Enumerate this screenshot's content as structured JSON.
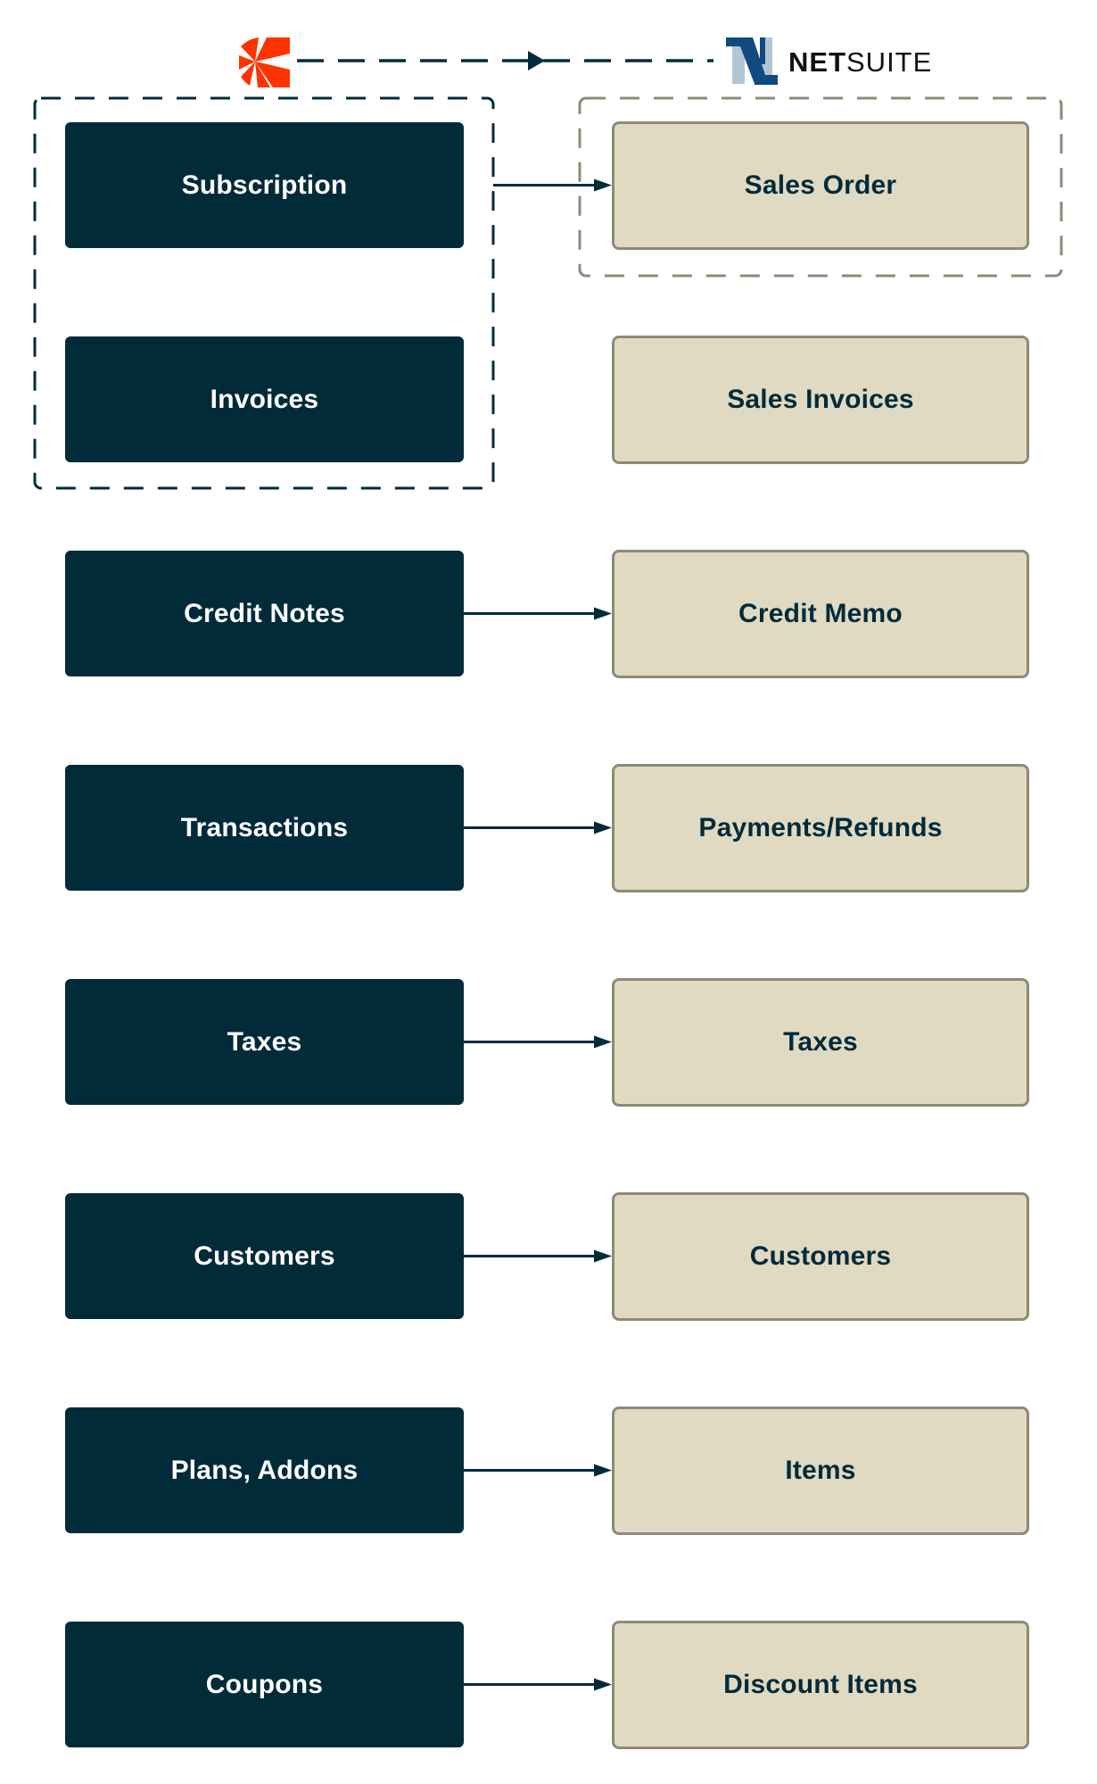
{
  "header": {
    "source_logo": "chargebee-logo",
    "target_logo": "netsuite-logo",
    "target_brand_bold": "NET",
    "target_brand_regular": "SUITE",
    "flow_direction_icon": "arrow-right-icon"
  },
  "colors": {
    "source_box": "#022b3a",
    "target_box": "#e0dac2",
    "target_border": "#8f8a77",
    "connector": "#022b3a",
    "chargebee_orange": "#ff3300",
    "netsuite_dark_blue": "#0f4a80",
    "netsuite_light_blue": "#b4c6d3"
  },
  "groups": {
    "source_group": [
      "Subscription",
      "Invoices"
    ],
    "target_group": [
      "Sales Order"
    ]
  },
  "mappings": [
    {
      "source": "Subscription",
      "target": "Sales Order"
    },
    {
      "source": "Invoices",
      "target": "Sales Invoices"
    },
    {
      "source": "Credit Notes",
      "target": "Credit Memo"
    },
    {
      "source": "Transactions",
      "target": "Payments/Refunds"
    },
    {
      "source": "Taxes",
      "target": "Taxes"
    },
    {
      "source": "Customers",
      "target": "Customers"
    },
    {
      "source": "Plans, Addons",
      "target": "Items"
    },
    {
      "source": "Coupons",
      "target": "Discount Items"
    }
  ]
}
